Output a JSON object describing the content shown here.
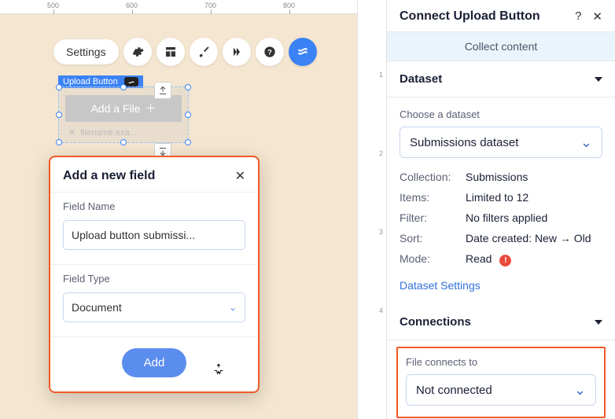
{
  "ruler": {
    "marks": [
      "500",
      "600",
      "700",
      "800"
    ]
  },
  "toolbar": {
    "settings_label": "Settings"
  },
  "element": {
    "badge": "Upload Button",
    "button_text": "Add a File",
    "placeholder_filename": "filename.exa..."
  },
  "modal": {
    "title": "Add a new field",
    "field_name_label": "Field Name",
    "field_name_value": "Upload button submissi...",
    "field_type_label": "Field Type",
    "field_type_value": "Document",
    "add_label": "Add"
  },
  "panel": {
    "title": "Connect Upload Button",
    "banner": "Collect content",
    "dataset_section": "Dataset",
    "choose_dataset_label": "Choose a dataset",
    "dataset_value": "Submissions dataset",
    "info": {
      "collection_k": "Collection:",
      "collection_v": "Submissions",
      "items_k": "Items:",
      "items_v": "Limited to 12",
      "filter_k": "Filter:",
      "filter_v": "No filters applied",
      "sort_k": "Sort:",
      "sort_v": "Date created: New → Old",
      "mode_k": "Mode:",
      "mode_v": "Read"
    },
    "dataset_settings": "Dataset Settings",
    "connections_section": "Connections",
    "file_connects_label": "File connects to",
    "file_connects_value": "Not connected"
  },
  "vruler": [
    "1",
    "2",
    "3",
    "4"
  ]
}
